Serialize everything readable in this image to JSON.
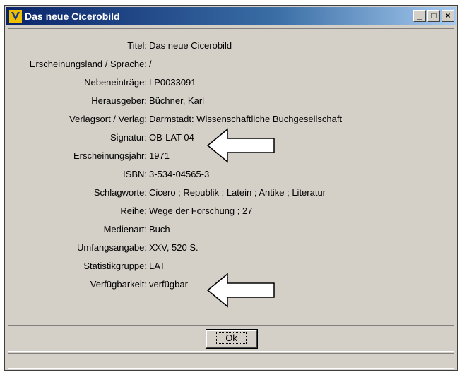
{
  "window": {
    "title": "Das neue Cicerobild",
    "min_glyph": "_",
    "max_glyph": "□",
    "close_glyph": "×"
  },
  "record": [
    {
      "label": "Titel:",
      "value": "Das neue Cicerobild"
    },
    {
      "label": "Erscheinungsland / Sprache:",
      "value": "/"
    },
    {
      "label": "Nebeneinträge:",
      "value": "LP0033091"
    },
    {
      "label": "Herausgeber:",
      "value": "Büchner, Karl"
    },
    {
      "label": "Verlagsort / Verlag:",
      "value": "Darmstadt: Wissenschaftliche Buchgesellschaft"
    },
    {
      "label": "Signatur:",
      "value": "OB-LAT 04"
    },
    {
      "label": "Erscheinungsjahr:",
      "value": "1971"
    },
    {
      "label": "ISBN:",
      "value": "3-534-04565-3"
    },
    {
      "label": "Schlagworte:",
      "value": "Cicero ; Republik ; Latein ; Antike ; Literatur"
    },
    {
      "label": "Reihe:",
      "value": "Wege der Forschung ; 27"
    },
    {
      "label": "Medienart:",
      "value": "Buch"
    },
    {
      "label": "Umfangsangabe:",
      "value": "XXV, 520 S."
    },
    {
      "label": "Statistikgruppe:",
      "value": "LAT"
    },
    {
      "label": "Verfügbarkeit:",
      "value": "verfügbar"
    }
  ],
  "buttons": {
    "ok": "Ok"
  },
  "colors": {
    "titlebar_start": "#0a246a",
    "titlebar_end": "#a6caf0",
    "dialog_bg": "#d4d0c8"
  },
  "icons": {
    "app": "library-logo-icon",
    "annotation": "left-arrow-icon"
  }
}
